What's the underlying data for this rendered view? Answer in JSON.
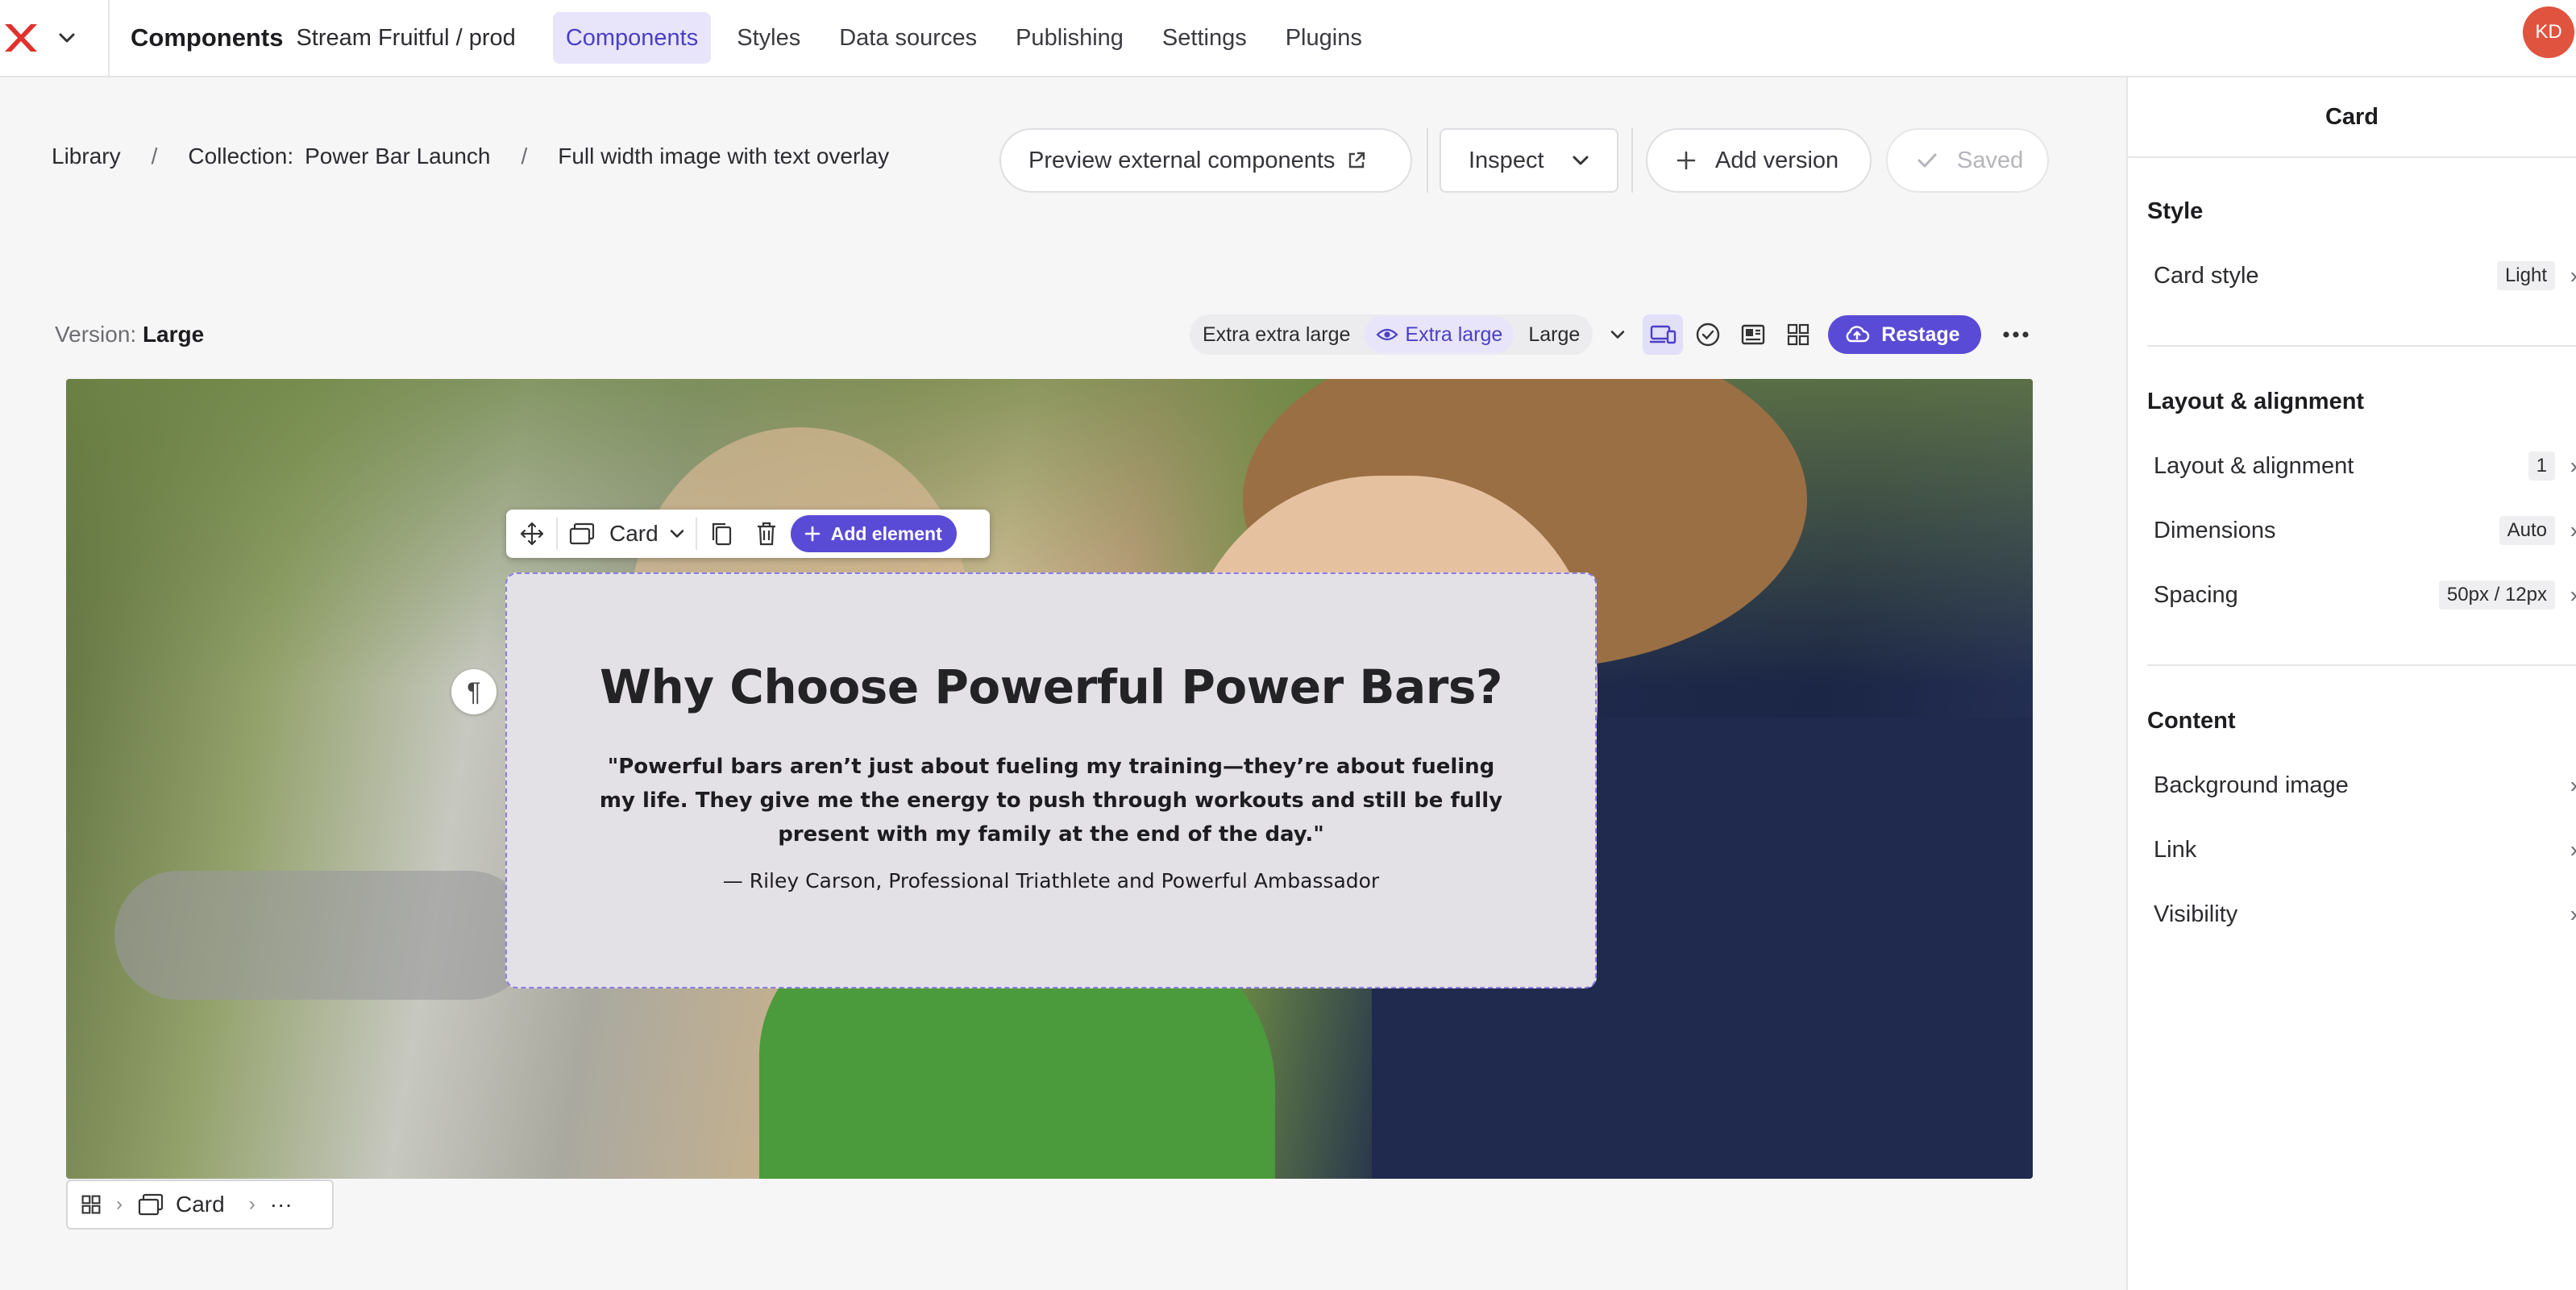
{
  "topbar": {
    "app_title": "Components",
    "project": "Stream Fruitful / prod",
    "tabs": [
      {
        "label": "Components",
        "active": true
      },
      {
        "label": "Styles",
        "active": false
      },
      {
        "label": "Data sources",
        "active": false
      },
      {
        "label": "Publishing",
        "active": false
      },
      {
        "label": "Settings",
        "active": false
      },
      {
        "label": "Plugins",
        "active": false
      }
    ],
    "avatar_initials": "KD",
    "avatar_color": "#e0533f",
    "logo_icon": "x-logo-icon"
  },
  "breadcrumb": {
    "library": "Library",
    "collection_prefix": "Collection:",
    "collection_name": "Power Bar Launch",
    "page": "Full width image with text overlay",
    "separator": "/"
  },
  "actions": {
    "preview": "Preview external components",
    "inspect": "Inspect",
    "add_version": "Add version",
    "saved": "Saved"
  },
  "version": {
    "prefix": "Version:",
    "name": "Large",
    "sizes": [
      "Extra extra large",
      "Extra large",
      "Large"
    ],
    "active_size": "Extra large",
    "restage": "Restage"
  },
  "card_toolbar": {
    "card_label": "Card",
    "add_element": "Add element"
  },
  "card": {
    "title": "Why Choose Powerful Power Bars?",
    "quote": "\"Powerful bars aren’t just about fueling my training—they’re about fueling my life. They give me the energy to push through workouts and still be fully present with my family at the end of the day.\"",
    "attribution": "— Riley Carson, Professional Triathlete and Powerful Ambassador",
    "paragraph_mark": "¶"
  },
  "mini_breadcrumb": {
    "card_label": "Card",
    "more": "···"
  },
  "panel": {
    "title": "Card",
    "sections": {
      "style": {
        "title": "Style",
        "rows": [
          {
            "label": "Card style",
            "value": "Light"
          }
        ]
      },
      "layout": {
        "title": "Layout & alignment",
        "rows": [
          {
            "label": "Layout & alignment",
            "value": "1"
          },
          {
            "label": "Dimensions",
            "value": "Auto"
          },
          {
            "label": "Spacing",
            "value": "50px / 12px"
          }
        ]
      },
      "content": {
        "title": "Content",
        "rows": [
          {
            "label": "Background image"
          },
          {
            "label": "Link"
          },
          {
            "label": "Visibility"
          }
        ]
      }
    }
  },
  "colors": {
    "accent": "#5a4bd6",
    "accent_soft": "#e8e5fb",
    "card_bg": "#e3e1e6"
  }
}
